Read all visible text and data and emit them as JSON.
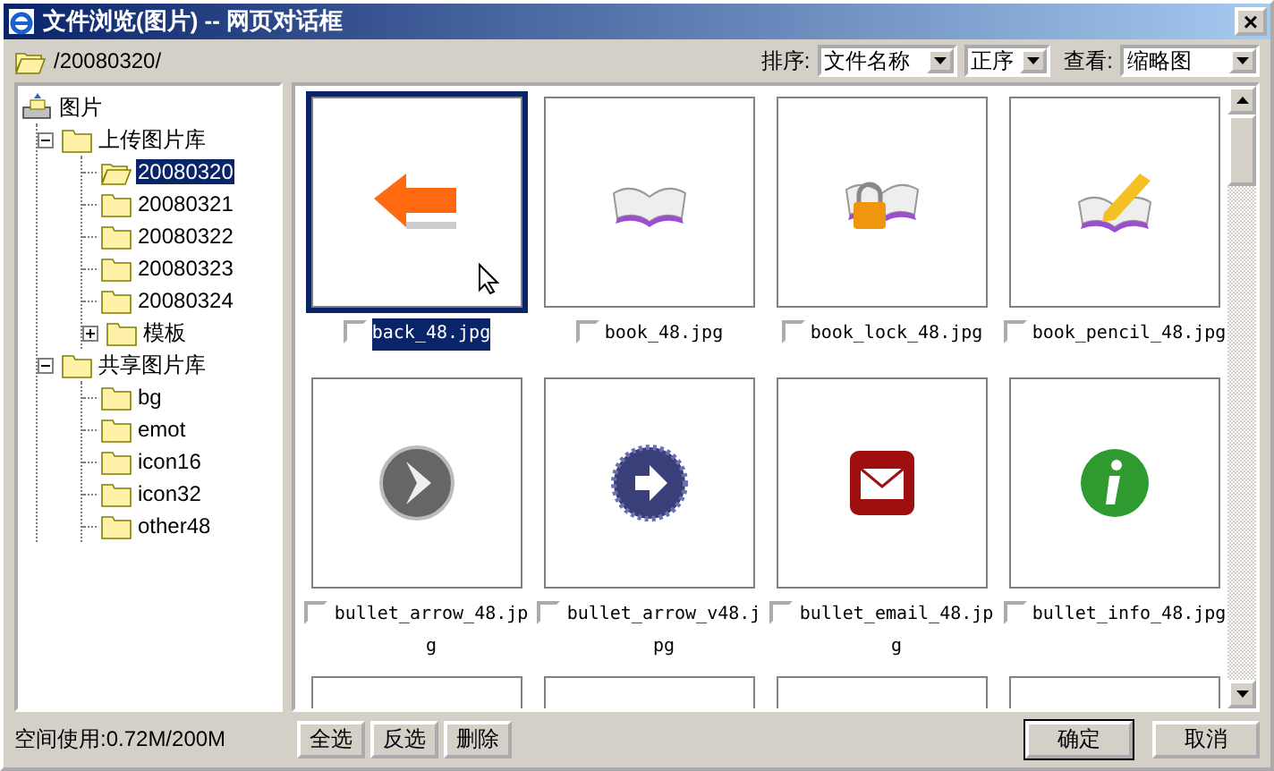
{
  "window": {
    "title": "文件浏览(图片) -- 网页对话框",
    "close": "×"
  },
  "path": "/20080320/",
  "toolbar": {
    "sort_label": "排序:",
    "sort_field": "文件名称",
    "sort_order": "正序",
    "view_label": "查看:",
    "view": "缩略图"
  },
  "tree": [
    {
      "label": "图片",
      "kind": "root",
      "selected": false,
      "children": [
        {
          "label": "上传图片库",
          "kind": "folder",
          "selected": false,
          "expanded": true,
          "children": [
            {
              "label": "20080320",
              "kind": "folder",
              "selected": true
            },
            {
              "label": "20080321",
              "kind": "folder",
              "selected": false
            },
            {
              "label": "20080322",
              "kind": "folder",
              "selected": false
            },
            {
              "label": "20080323",
              "kind": "folder",
              "selected": false
            },
            {
              "label": "20080324",
              "kind": "folder",
              "selected": false
            },
            {
              "label": "模板",
              "kind": "folder",
              "selected": false,
              "expanded": false
            }
          ]
        },
        {
          "label": "共享图片库",
          "kind": "folder",
          "selected": false,
          "expanded": true,
          "children": [
            {
              "label": "bg",
              "kind": "folder",
              "selected": false
            },
            {
              "label": "emot",
              "kind": "folder",
              "selected": false
            },
            {
              "label": "icon16",
              "kind": "folder",
              "selected": false
            },
            {
              "label": "icon32",
              "kind": "folder",
              "selected": false
            },
            {
              "label": "other48",
              "kind": "folder",
              "selected": false
            }
          ]
        }
      ]
    }
  ],
  "thumbnails": [
    {
      "kind": "file",
      "name": "back_48.jpg",
      "selected": true,
      "checked": false
    },
    {
      "kind": "file",
      "name": "book_48.jpg",
      "selected": false,
      "checked": false
    },
    {
      "kind": "file",
      "name": "book_lock_48.jpg",
      "selected": false,
      "checked": false
    },
    {
      "kind": "file",
      "name": "book_pencil_48.jpg",
      "selected": false,
      "checked": false
    },
    {
      "kind": "file",
      "name": "bullet_arrow_48.jpg",
      "selected": false,
      "checked": false
    },
    {
      "kind": "file",
      "name": "bullet_arrow_v48.jpg",
      "selected": false,
      "checked": false
    },
    {
      "kind": "file",
      "name": "bullet_email_48.jpg",
      "selected": false,
      "checked": false
    },
    {
      "kind": "file",
      "name": "bullet_info_48.jpg",
      "selected": false,
      "checked": false
    },
    {
      "kind": "partial"
    },
    {
      "kind": "partial"
    },
    {
      "kind": "partial"
    },
    {
      "kind": "partial"
    }
  ],
  "status": "空间使用:0.72M/200M",
  "actions": [
    "全选",
    "反选",
    "删除"
  ],
  "dialog_buttons": [
    {
      "label": "确定",
      "default": true
    },
    {
      "label": "取消",
      "default": false
    }
  ]
}
